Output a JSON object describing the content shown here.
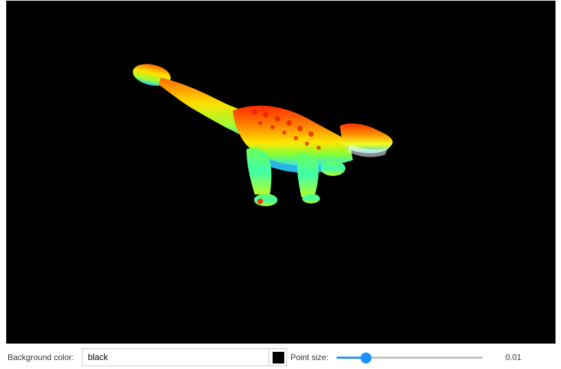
{
  "viewer": {
    "background": "#000000",
    "model": "dinosaur-point-cloud",
    "colormap": [
      "#0000ff",
      "#00ffff",
      "#00ff00",
      "#ffff00",
      "#ff8000",
      "#ff0000"
    ]
  },
  "controls": {
    "background_color_label": "Background color:",
    "background_color_value": "black",
    "background_swatch_color": "#000000",
    "point_size_label": "Point size:",
    "point_size_value": "0.01",
    "point_size_fraction": 0.2,
    "accent_color": "#1e90ff"
  }
}
